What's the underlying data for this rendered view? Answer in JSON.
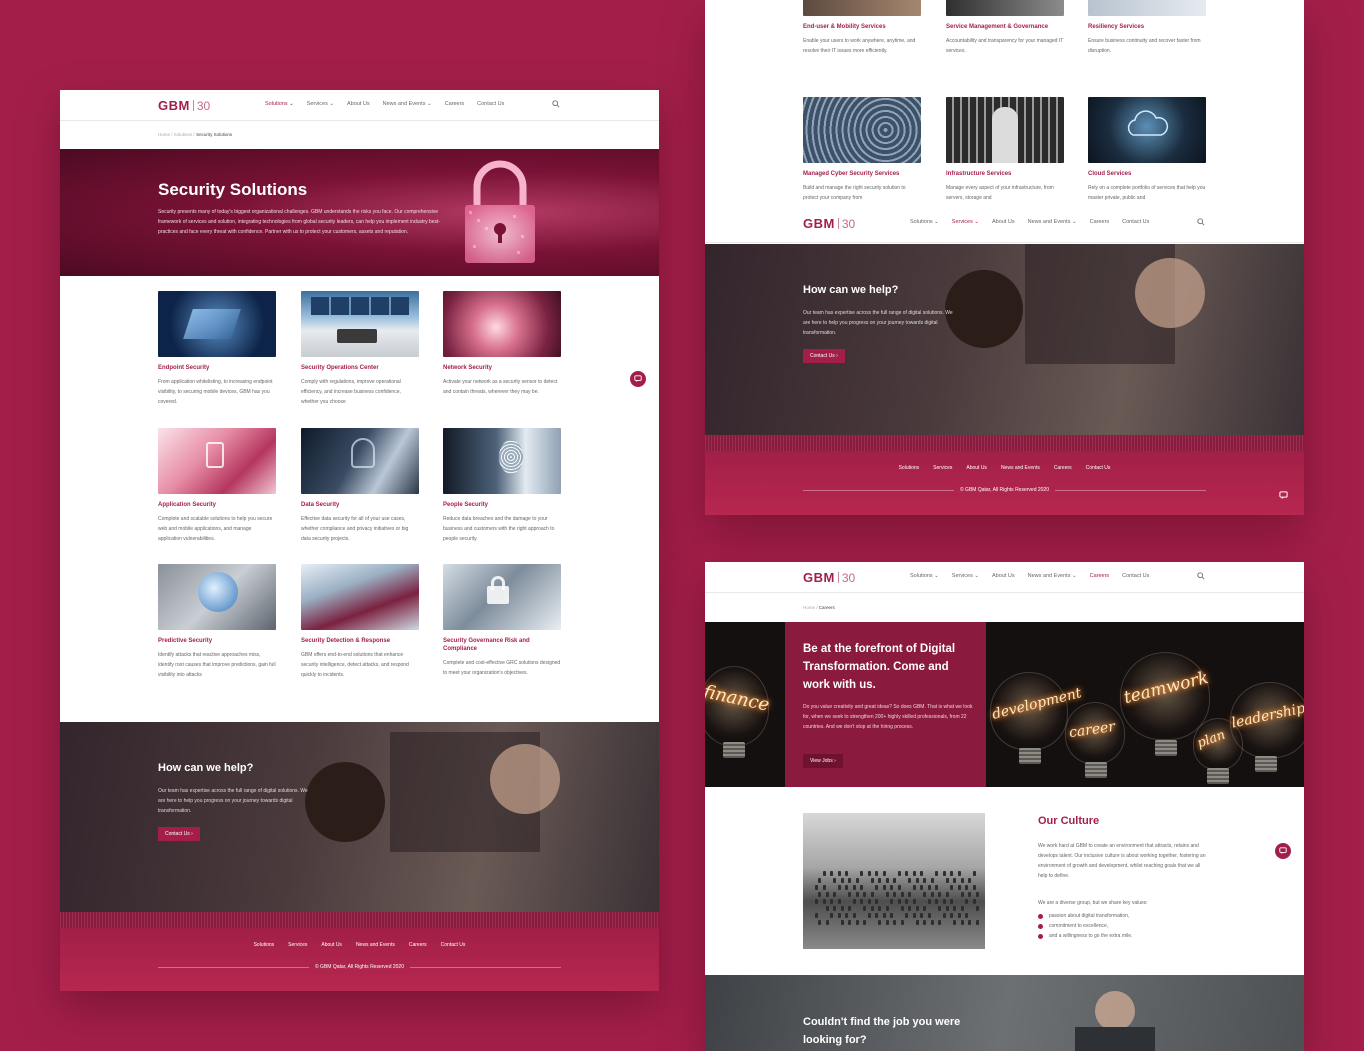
{
  "colors": {
    "background": "#a31f4a",
    "brand": "#a31f4a",
    "footer": "#b1264e"
  },
  "nav": {
    "logo_text": "GBM",
    "logo_anniversary": "30",
    "items": [
      {
        "label": "Solutions",
        "has_dropdown": true
      },
      {
        "label": "Services",
        "has_dropdown": true
      },
      {
        "label": "About Us",
        "has_dropdown": false
      },
      {
        "label": "News and Events",
        "has_dropdown": true
      },
      {
        "label": "Careers",
        "has_dropdown": false
      },
      {
        "label": "Contact Us",
        "has_dropdown": false
      }
    ],
    "search_icon": "search-icon"
  },
  "main_page": {
    "breadcrumb": {
      "home": "Home",
      "section": "Solutions",
      "current": "Security Solutions"
    },
    "hero": {
      "title": "Security Solutions",
      "description": "Security presents many of today's biggest organizational challenges. GBM understands the risks you face. Our comprehensive framework of services and solution, integrating technologies from global security leaders, can help you implement industry best-practices and face every threat with confidence. Partner with us to protect your customers, assets and reputation."
    },
    "cards": [
      {
        "title": "Endpoint Security",
        "desc": "From application whitelisting, to increasing endpoint visibility, to securing mobile devices, GBM has you covered."
      },
      {
        "title": "Security Operations Center",
        "desc": "Comply with regulations, improve operational efficiency, and increase business confidence, whether you choose"
      },
      {
        "title": "Network Security",
        "desc": "Activate your network as a security sensor to detect and contain threats, wherever they may be."
      },
      {
        "title": "Application Security",
        "desc": "Complete and scalable solutions to help you secure web and mobile applications, and manage application vulnerabilities."
      },
      {
        "title": "Data Security",
        "desc": "Effective data security for all of your use cases, whether compliance and privacy initiatives or big data security projects."
      },
      {
        "title": "People Security",
        "desc": "Reduce data breaches and the damage to your business and customers with the right approach to people security."
      },
      {
        "title": "Predictive Security",
        "desc": "Identify attacks that reactive approaches miss, identify root causes that improve predictions, gain full visibility into attacks"
      },
      {
        "title": "Security Detection & Response",
        "desc": "GBM offers end-to-end solutions that enhance security intelligence, detect attacks, and respond quickly to incidents."
      },
      {
        "title": "Security Governance Risk and Compliance",
        "desc": "Complete and cost-effective GRC solutions designed to meet your organization's objectives."
      }
    ]
  },
  "services_page": {
    "cards_top": [
      {
        "title": "End-user & Mobility Services",
        "desc": "Enable your users to work anywhere, anytime, and resolve their IT issues more efficiently."
      },
      {
        "title": "Service Management & Governance",
        "desc": "Accountability and transparency for your managed IT services."
      },
      {
        "title": "Resiliency Services",
        "desc": "Ensure business continuity and recover faster from disruption."
      }
    ],
    "cards_bottom": [
      {
        "title": "Managed Cyber Security Services",
        "desc": "Build and manage the right security solution to protect your company from"
      },
      {
        "title": "Infrastructure Services",
        "desc": "Manage every aspect of your infrastructure, from servers, storage and"
      },
      {
        "title": "Cloud Services",
        "desc": "Rely on a complete portfolio of services that help you master private, public and"
      }
    ]
  },
  "help": {
    "title": "How can we help?",
    "text": "Our team has expertise across the full range of digital solutions. We are here to help you progress on your journey towards digital transformation.",
    "button": "Contact Us ›"
  },
  "footer": {
    "links": [
      "Solutions",
      "Services",
      "About Us",
      "News and Events",
      "Careers",
      "Contact Us"
    ],
    "copyright": "© GBM Qatar, All Rights Reserved 2020"
  },
  "careers_page": {
    "breadcrumb": {
      "home": "Home",
      "current": "Careers"
    },
    "hero": {
      "title": "Be at the forefront of Digital Transformation. Come and work with us.",
      "text": "Do you value creativity and great ideas? So does GBM. That is what we look for, when we seek to strengthen 200+ highly skilled professionals, from 22 countries. And we don't stop at the hiring process.",
      "button": "View Jobs ›",
      "bulb_words": [
        "finance",
        "development",
        "career",
        "teamwork",
        "plan",
        "leadership"
      ]
    },
    "culture": {
      "title": "Our Culture",
      "text": "We work hard at GBM to create an environment that attracts, retains and develops talent. Our inclusive culture is about working together, fostering an environment of growth and development, whilst reaching goals that we all help to define.",
      "values_intro": "We are a diverse group, but we share key values:",
      "values": [
        "passion about digital transformation,",
        "commitment to excellence,",
        "and a willingness to go the extra mile."
      ]
    },
    "job_band_title": "Couldn't find the job you were looking for?"
  }
}
